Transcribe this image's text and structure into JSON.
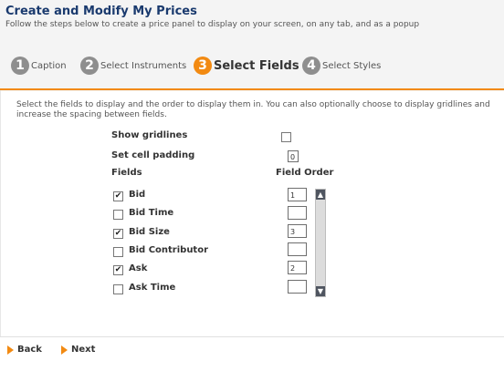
{
  "header": {
    "title": "Create and Modify My Prices",
    "intro": "Follow the steps below to create a price panel to display on your screen, on any tab, and as a popup"
  },
  "steps": [
    {
      "num": "1",
      "label": "Caption",
      "active": false
    },
    {
      "num": "2",
      "label": "Select Instruments",
      "active": false
    },
    {
      "num": "3",
      "label": "Select Fields",
      "active": true
    },
    {
      "num": "4",
      "label": "Select Styles",
      "active": false
    }
  ],
  "description": "Select the fields to display and the order to display them in. You can also optionally choose to display gridlines and increase the spacing between fields.",
  "options": {
    "gridlines_label": "Show gridlines",
    "gridlines_checked": false,
    "padding_label": "Set cell padding",
    "padding_value": "0"
  },
  "fields_header": "Fields",
  "order_header": "Field Order",
  "fields": [
    {
      "label": "Bid",
      "checked": true,
      "order": "1"
    },
    {
      "label": "Bid Time",
      "checked": false,
      "order": ""
    },
    {
      "label": "Bid Size",
      "checked": true,
      "order": "3"
    },
    {
      "label": "Bid Contributor",
      "checked": false,
      "order": ""
    },
    {
      "label": "Ask",
      "checked": true,
      "order": "2"
    },
    {
      "label": "Ask Time",
      "checked": false,
      "order": ""
    }
  ],
  "nav": {
    "back": "Back",
    "next": "Next"
  },
  "colors": {
    "accent": "#f28a12",
    "title": "#1a3a6e",
    "step_inactive": "#8e8e8e"
  }
}
